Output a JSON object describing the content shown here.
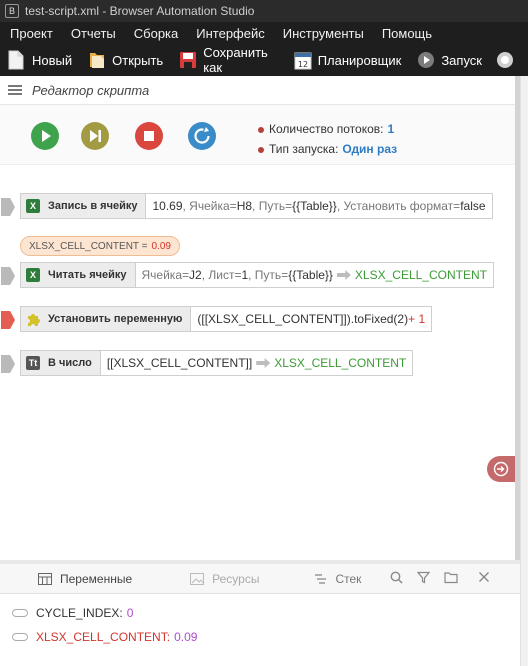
{
  "window": {
    "title": "test-script.xml - Browser Automation Studio"
  },
  "menu": [
    "Проект",
    "Отчеты",
    "Сборка",
    "Интерфейс",
    "Инструменты",
    "Помощь"
  ],
  "toolbar": {
    "new": "Новый",
    "open": "Открыть",
    "save_as": "Сохранить как",
    "scheduler": "Планировщик",
    "scheduler_badge": "12",
    "run": "Запуск"
  },
  "editor": {
    "title": "Редактор скрипта"
  },
  "run_info": {
    "threads_label": "Количество потоков:",
    "threads_value": "1",
    "mode_label": "Тип запуска:",
    "mode_value": "Один раз"
  },
  "actions": [
    {
      "title": "Запись в ячейку",
      "icon": "excel-icon",
      "p1": "10.69",
      "p2": ", Ячейка=",
      "p3": "H8",
      "p4": ", Путь=",
      "p5": "{{Table}}",
      "p6": ", Установить формат=",
      "p7": "false"
    },
    {
      "title": "Читать ячейку",
      "icon": "excel-icon",
      "p1": "Ячейка=",
      "p2": "J2",
      "p3": ", Лист=",
      "p4": "1",
      "p5": ", Путь=",
      "p6": "{{Table}}",
      "out": "XLSX_CELL_CONTENT"
    },
    {
      "title": "Установить переменную",
      "icon": "puzzle-icon",
      "p1": "([[XLSX_CELL_CONTENT]]).toFixed(2)",
      "p2": " + 1"
    },
    {
      "title": "В число",
      "icon": "text-type-icon",
      "icon_text": "Tt",
      "p1": "[[XLSX_CELL_CONTENT]]",
      "out": "XLSX_CELL_CONTENT"
    }
  ],
  "debug_chip": {
    "label": "XLSX_CELL_CONTENT =",
    "value": "0.09"
  },
  "bottom_tabs": {
    "variables": "Переменные",
    "resources": "Ресурсы",
    "stack": "Стек"
  },
  "variables": [
    {
      "name": "CYCLE_INDEX:",
      "value": "0"
    },
    {
      "name": "XLSX_CELL_CONTENT:",
      "value": "0.09"
    }
  ],
  "colors": {
    "accent_blue": "#2f7cc4",
    "green": "#3a9b35",
    "red": "#d2342c",
    "purple": "#b04bd0"
  }
}
